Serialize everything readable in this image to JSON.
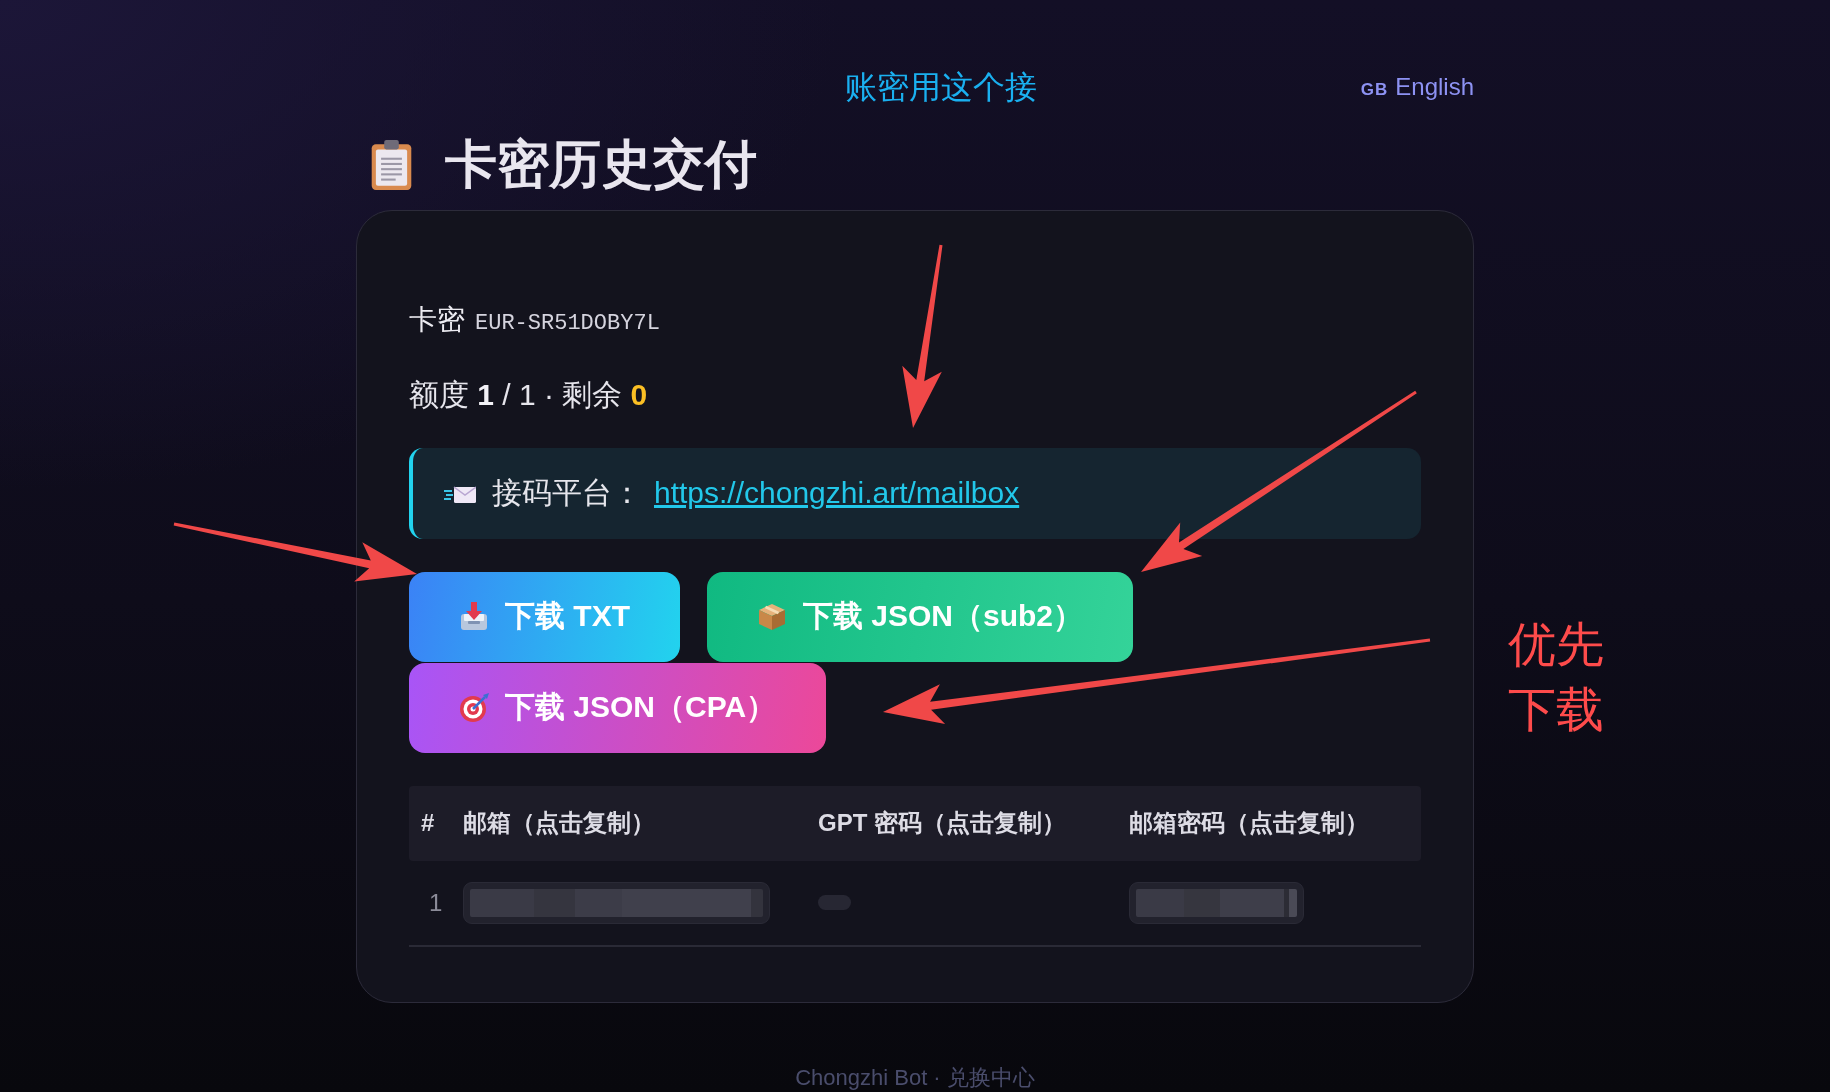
{
  "header": {
    "notice": "账密用这个接",
    "language": {
      "flag": "GB",
      "label": "English"
    }
  },
  "page_title": "卡密历史交付",
  "card": {
    "key": {
      "label": "卡密",
      "value": "EUR-SR51DOBY7L"
    },
    "quota": {
      "text": "额度 **1** / 1 · 剩余",
      "remaining": "0"
    },
    "mailbox": {
      "label": "接码平台：",
      "link": "https://chongzhi.art/mailbox"
    },
    "buttons": [
      {
        "kind": "txt",
        "label": "下载 TXT"
      },
      {
        "kind": "sub2",
        "label": "下载 JSON（sub2）"
      },
      {
        "kind": "cpa",
        "label": "下载 JSON（CPA）"
      }
    ],
    "table": {
      "columns": [
        "#",
        "邮箱（点击复制）",
        "GPT 密码（点击复制）",
        "邮箱密码（点击复制）"
      ],
      "rows": [
        {
          "cells": [
            {
              "kind": "index",
              "text": "1"
            },
            {
              "kind": "redacted"
            },
            {
              "kind": "empty"
            },
            {
              "kind": "redacted"
            }
          ]
        }
      ]
    }
  },
  "footer": "Chongzhi Bot · 兑换中心",
  "annotation": {
    "note": "优先下载"
  }
}
